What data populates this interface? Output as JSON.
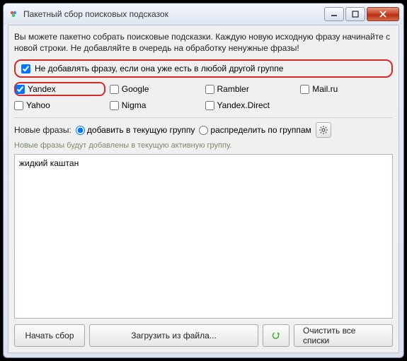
{
  "window": {
    "title": "Пакетный сбор поисковых подсказок"
  },
  "intro": "Вы можете пакетно собрать поисковые подсказки. Каждую новую исходную фразу начинайте с новой строки. Не добавляйте в очередь на обработку ненужные фразы!",
  "dedupe": {
    "label": "Не добавлять фразу, если она уже есть в любой другой группе",
    "checked": true
  },
  "engines": [
    {
      "id": "yandex",
      "label": "Yandex",
      "checked": true,
      "highlight": true
    },
    {
      "id": "google",
      "label": "Google",
      "checked": false
    },
    {
      "id": "rambler",
      "label": "Rambler",
      "checked": false
    },
    {
      "id": "mailru",
      "label": "Mail.ru",
      "checked": false
    },
    {
      "id": "yahoo",
      "label": "Yahoo",
      "checked": false
    },
    {
      "id": "nigma",
      "label": "Nigma",
      "checked": false
    },
    {
      "id": "ydirect",
      "label": "Yandex.Direct",
      "checked": false
    }
  ],
  "mode": {
    "label": "Новые фразы:",
    "options": [
      {
        "id": "current",
        "label": "добавить в текущую группу",
        "checked": true
      },
      {
        "id": "distribute",
        "label": "распределить по группам",
        "checked": false
      }
    ]
  },
  "hint": "Новые фразы будут добавлены в текущую активную группу.",
  "textarea": {
    "value": "жидкий каштан"
  },
  "buttons": {
    "start": "Начать сбор",
    "load": "Загрузить из файла...",
    "clear": "Очистить все списки"
  }
}
